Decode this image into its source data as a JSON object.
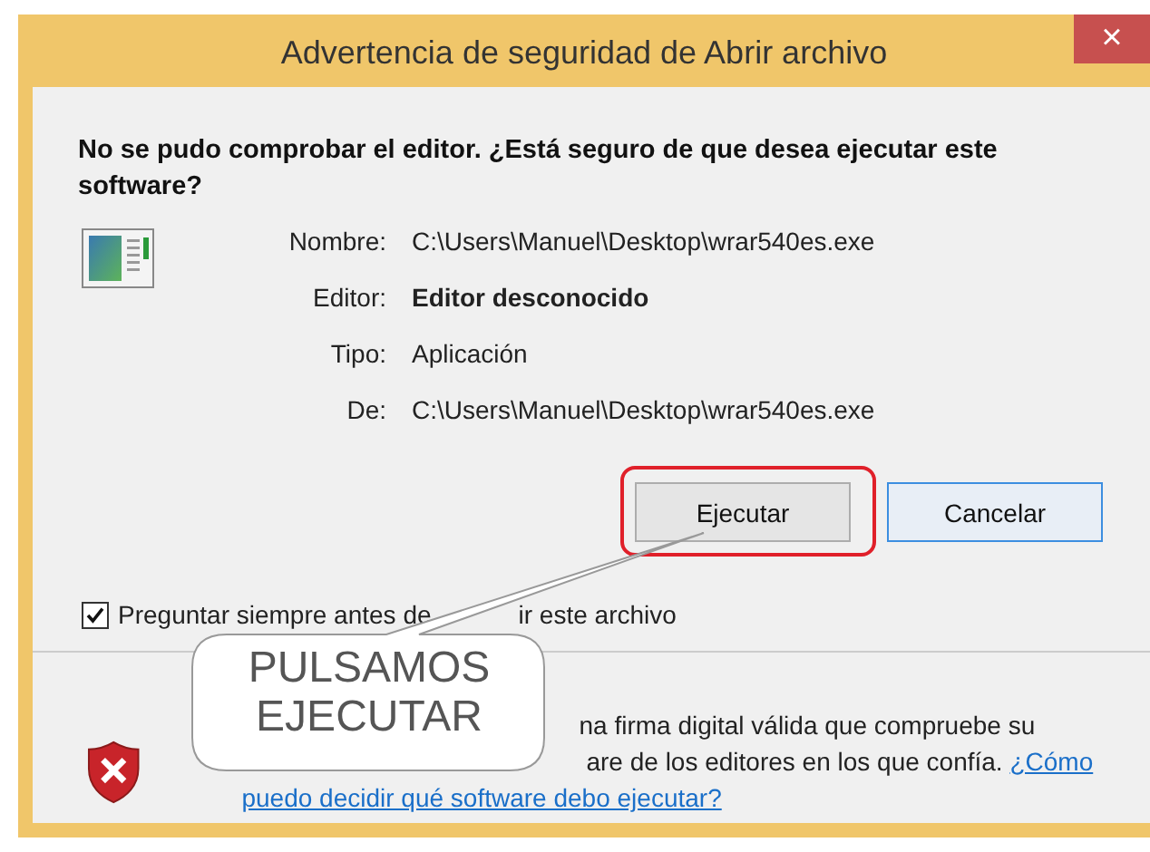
{
  "window": {
    "title": "Advertencia de seguridad de Abrir archivo",
    "close": "×"
  },
  "heading": "No se pudo comprobar el editor. ¿Está seguro de que desea ejecutar este software?",
  "details": [
    {
      "label": "Nombre:",
      "value": "C:\\Users\\Manuel\\Desktop\\wrar540es.exe",
      "bold": false
    },
    {
      "label": "Editor:",
      "value": "Editor desconocido",
      "bold": true
    },
    {
      "label": "Tipo:",
      "value": "Aplicación",
      "bold": false
    },
    {
      "label": "De:",
      "value": "C:\\Users\\Manuel\\Desktop\\wrar540es.exe",
      "bold": false
    }
  ],
  "buttons": [
    {
      "label": "Ejecutar",
      "default": false,
      "highlighted": true
    },
    {
      "label": "Cancelar",
      "default": true,
      "highlighted": false
    }
  ],
  "checkbox": {
    "checked": true,
    "label_parts": [
      "Preguntar siempre antes de",
      "ir este archivo"
    ]
  },
  "footer": {
    "text_parts": [
      "na firma digital válida que compruebe su",
      "are de los editores en los que confía."
    ],
    "link": "¿Cómo puedo decidir qué software debo ejecutar?"
  },
  "callout": {
    "text": "PULSAMOS EJECUTAR"
  }
}
